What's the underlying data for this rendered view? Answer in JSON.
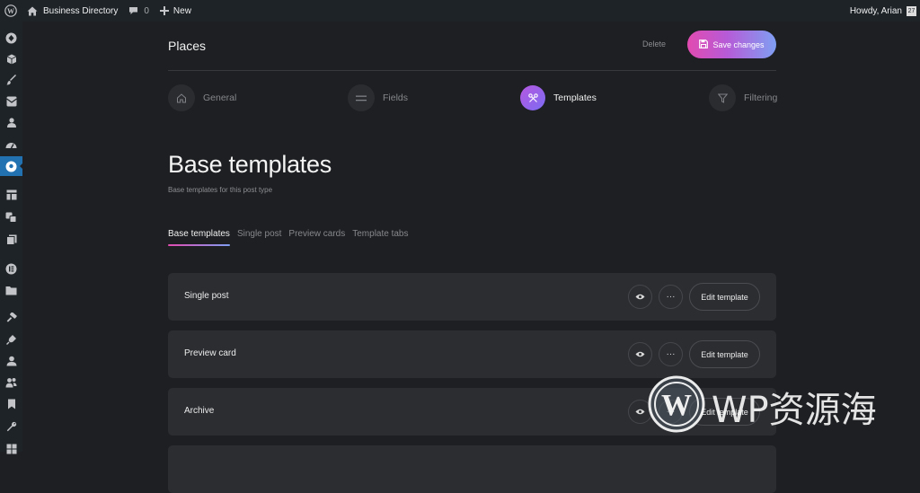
{
  "admin_bar": {
    "site_name": "Business Directory",
    "comments_count": "0",
    "new_label": "New",
    "greeting": "Howdy, Arian",
    "avatar_text": "27"
  },
  "sidebar": {
    "items": [
      "cube-badge-icon",
      "box-icon",
      "brush-icon",
      "grid-mail-icon",
      "user-badge-icon",
      "gauge-icon",
      "location-pin-icon",
      "layout-icon",
      "paintbrush-icon",
      "pages-icon",
      "elementor-icon",
      "folder-icon",
      "hammer-icon",
      "plug-icon",
      "user-icon",
      "users-icon",
      "bookmark-icon",
      "wrench-icon",
      "grid-icon"
    ],
    "active_index": 6
  },
  "header": {
    "title": "Places",
    "delete_label": "Delete",
    "save_label": "Save changes"
  },
  "steps": [
    {
      "label": "General",
      "icon": "home-icon"
    },
    {
      "label": "Fields",
      "icon": "equals-icon"
    },
    {
      "label": "Templates",
      "icon": "scissors-icon",
      "active": true
    },
    {
      "label": "Filtering",
      "icon": "filter-icon"
    }
  ],
  "section": {
    "title": "Base templates",
    "subtitle": "Base templates for this post type"
  },
  "tabs": [
    {
      "label": "Base templates",
      "active": true
    },
    {
      "label": "Single post"
    },
    {
      "label": "Preview cards"
    },
    {
      "label": "Template tabs"
    }
  ],
  "templates": [
    {
      "name": "Single post",
      "edit_label": "Edit template",
      "more_label": "···"
    },
    {
      "name": "Preview card",
      "edit_label": "Edit template",
      "more_label": "···"
    },
    {
      "name": "Archive",
      "edit_label": "Edit template",
      "more_label": "···"
    }
  ],
  "watermark": {
    "text": "WP资源海"
  },
  "colors": {
    "accent_start": "#e24bb0",
    "accent_end": "#7f9ff3",
    "wp_active": "#2271b1",
    "background": "#1d1f22"
  }
}
